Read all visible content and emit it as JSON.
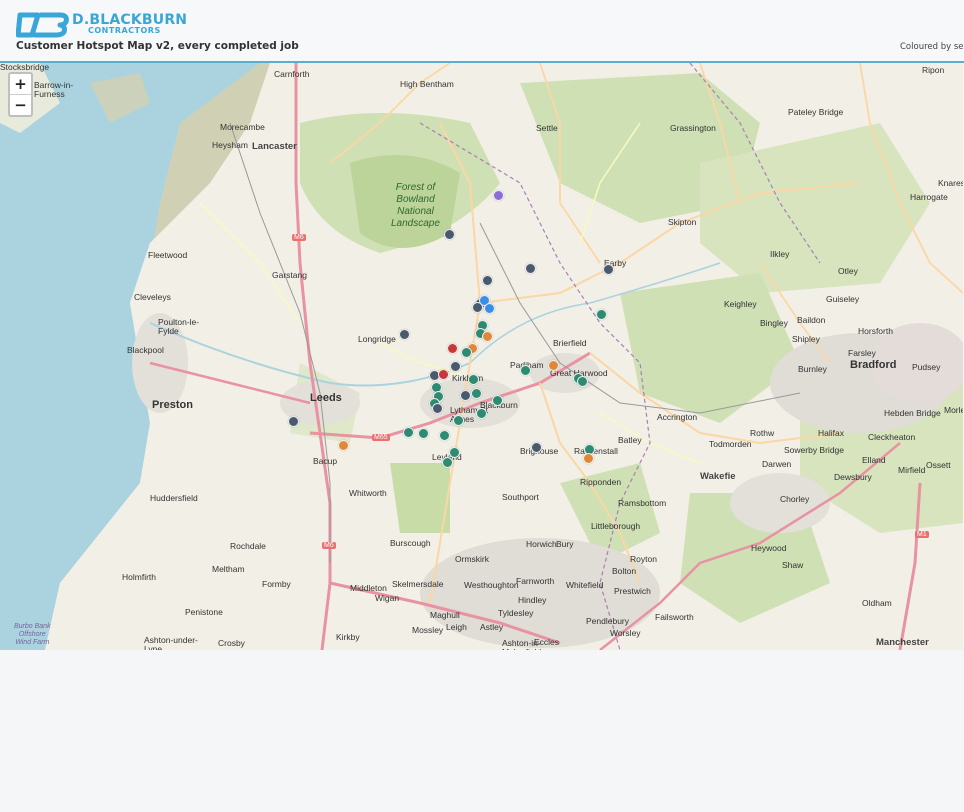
{
  "header": {
    "brand": "D.BLACKBURN",
    "brand_sub": "CONTRACTORS",
    "title": "Customer Hotspot Map v2, every completed job",
    "legend_note": "Coloured by se"
  },
  "zoom": {
    "in_label": "+",
    "out_label": "−"
  },
  "colors": {
    "brand": "#3aa6d8",
    "marker_slate": "#4a5a6e",
    "marker_teal": "#2f8a72",
    "marker_orange": "#e0883a",
    "marker_red": "#c43a3a",
    "marker_purple": "#8a6fd8",
    "marker_blue": "#3a8ee6"
  },
  "map": {
    "park_label": "Forest of\nBowland\nNational\nLandscape",
    "sea_label": "Burbo Bank\nOffshore\nWind Farm",
    "places": [
      {
        "name": "Carnforth",
        "cls": "town"
      },
      {
        "name": "High Bentham",
        "cls": "town"
      },
      {
        "name": "Ripon",
        "cls": "town"
      },
      {
        "name": "Barrow-in-\nFurness",
        "cls": "town"
      },
      {
        "name": "Pateley Bridge",
        "cls": "town"
      },
      {
        "name": "Morecambe",
        "cls": "town"
      },
      {
        "name": "Settle",
        "cls": "town"
      },
      {
        "name": "Grassington",
        "cls": "town"
      },
      {
        "name": "Heysham",
        "cls": "town"
      },
      {
        "name": "Lancaster",
        "cls": "big"
      },
      {
        "name": "Knares",
        "cls": "town"
      },
      {
        "name": "Harrogate",
        "cls": "town"
      },
      {
        "name": "Skipton",
        "cls": "town"
      },
      {
        "name": "Fleetwood",
        "cls": "town"
      },
      {
        "name": "Ilkley",
        "cls": "town"
      },
      {
        "name": "Garstang",
        "cls": "town"
      },
      {
        "name": "Otley",
        "cls": "town"
      },
      {
        "name": "Cleveleys",
        "cls": "town"
      },
      {
        "name": "Earby",
        "cls": "town"
      },
      {
        "name": "Poulton-le-\nFylde",
        "cls": "town"
      },
      {
        "name": "Keighley",
        "cls": "town"
      },
      {
        "name": "Guiseley",
        "cls": "town"
      },
      {
        "name": "Longridge",
        "cls": "town"
      },
      {
        "name": "Baildon",
        "cls": "town"
      },
      {
        "name": "Bingley",
        "cls": "town"
      },
      {
        "name": "Horsforth",
        "cls": "town"
      },
      {
        "name": "Blackpool",
        "cls": "town"
      },
      {
        "name": "Brierfield",
        "cls": "town"
      },
      {
        "name": "Shipley",
        "cls": "town"
      },
      {
        "name": "Farsley",
        "cls": "town"
      },
      {
        "name": "Padiham",
        "cls": "town"
      },
      {
        "name": "Kirkham",
        "cls": "town"
      },
      {
        "name": "Great Harwood",
        "cls": "town"
      },
      {
        "name": "Burnley",
        "cls": "town"
      },
      {
        "name": "Bradford",
        "cls": "city"
      },
      {
        "name": "Pudsey",
        "cls": "town"
      },
      {
        "name": "Leeds",
        "cls": "city"
      },
      {
        "name": "Preston",
        "cls": "city"
      },
      {
        "name": "Lytham St\nAnnes",
        "cls": "town"
      },
      {
        "name": "Blackburn",
        "cls": "town"
      },
      {
        "name": "Accrington",
        "cls": "town"
      },
      {
        "name": "Hebden Bridge",
        "cls": "town"
      },
      {
        "name": "Morley",
        "cls": "town"
      },
      {
        "name": "Rothw",
        "cls": "town"
      },
      {
        "name": "Halifax",
        "cls": "town"
      },
      {
        "name": "Cleckheaton",
        "cls": "town"
      },
      {
        "name": "Batley",
        "cls": "town"
      },
      {
        "name": "Todmorden",
        "cls": "town"
      },
      {
        "name": "Sowerby Bridge",
        "cls": "town"
      },
      {
        "name": "Brighouse",
        "cls": "town"
      },
      {
        "name": "Rawtenstall",
        "cls": "town"
      },
      {
        "name": "Bacup",
        "cls": "town"
      },
      {
        "name": "Leyland",
        "cls": "town"
      },
      {
        "name": "Darwen",
        "cls": "town"
      },
      {
        "name": "Elland",
        "cls": "town"
      },
      {
        "name": "Dewsbury",
        "cls": "town"
      },
      {
        "name": "Mirfield",
        "cls": "town"
      },
      {
        "name": "Ossett",
        "cls": "town"
      },
      {
        "name": "Wakefie",
        "cls": "big"
      },
      {
        "name": "Ripponden",
        "cls": "town"
      },
      {
        "name": "Whitworth",
        "cls": "town"
      },
      {
        "name": "Chorley",
        "cls": "town"
      },
      {
        "name": "Huddersfield",
        "cls": "town"
      },
      {
        "name": "Southport",
        "cls": "town"
      },
      {
        "name": "Ramsbottom",
        "cls": "town"
      },
      {
        "name": "Littleborough",
        "cls": "town"
      },
      {
        "name": "Rochdale",
        "cls": "town"
      },
      {
        "name": "Burscough",
        "cls": "town"
      },
      {
        "name": "Horwich",
        "cls": "town"
      },
      {
        "name": "Bury",
        "cls": "town"
      },
      {
        "name": "Heywood",
        "cls": "town"
      },
      {
        "name": "Meltham",
        "cls": "town"
      },
      {
        "name": "Ormskirk",
        "cls": "town"
      },
      {
        "name": "Bolton",
        "cls": "town"
      },
      {
        "name": "Royton",
        "cls": "town"
      },
      {
        "name": "Shaw",
        "cls": "town"
      },
      {
        "name": "Holmfirth",
        "cls": "town"
      },
      {
        "name": "Formby",
        "cls": "town"
      },
      {
        "name": "Skelmersdale",
        "cls": "town"
      },
      {
        "name": "Westhoughton",
        "cls": "town"
      },
      {
        "name": "Farnworth",
        "cls": "town"
      },
      {
        "name": "Whitefield",
        "cls": "town"
      },
      {
        "name": "Middleton",
        "cls": "town"
      },
      {
        "name": "Wigan",
        "cls": "town"
      },
      {
        "name": "Hindley",
        "cls": "town"
      },
      {
        "name": "Prestwich",
        "cls": "town"
      },
      {
        "name": "Oldham",
        "cls": "town"
      },
      {
        "name": "Penistone",
        "cls": "town"
      },
      {
        "name": "Maghull",
        "cls": "town"
      },
      {
        "name": "Tyldesley",
        "cls": "town"
      },
      {
        "name": "Pendlebury",
        "cls": "town"
      },
      {
        "name": "Failsworth",
        "cls": "town"
      },
      {
        "name": "Mossley",
        "cls": "town"
      },
      {
        "name": "Leigh",
        "cls": "town"
      },
      {
        "name": "Astley",
        "cls": "town"
      },
      {
        "name": "Worsley",
        "cls": "town"
      },
      {
        "name": "Ashton-under-\nLyne",
        "cls": "town"
      },
      {
        "name": "Crosby",
        "cls": "town"
      },
      {
        "name": "Kirkby",
        "cls": "town"
      },
      {
        "name": "Ashton-in-\nMakerfield",
        "cls": "town"
      },
      {
        "name": "Eccles",
        "cls": "town"
      },
      {
        "name": "Manchester",
        "cls": "big"
      },
      {
        "name": "Stocksbridge",
        "cls": "town"
      }
    ],
    "road_shields": [
      "M6",
      "M65",
      "M6",
      "M1"
    ]
  }
}
